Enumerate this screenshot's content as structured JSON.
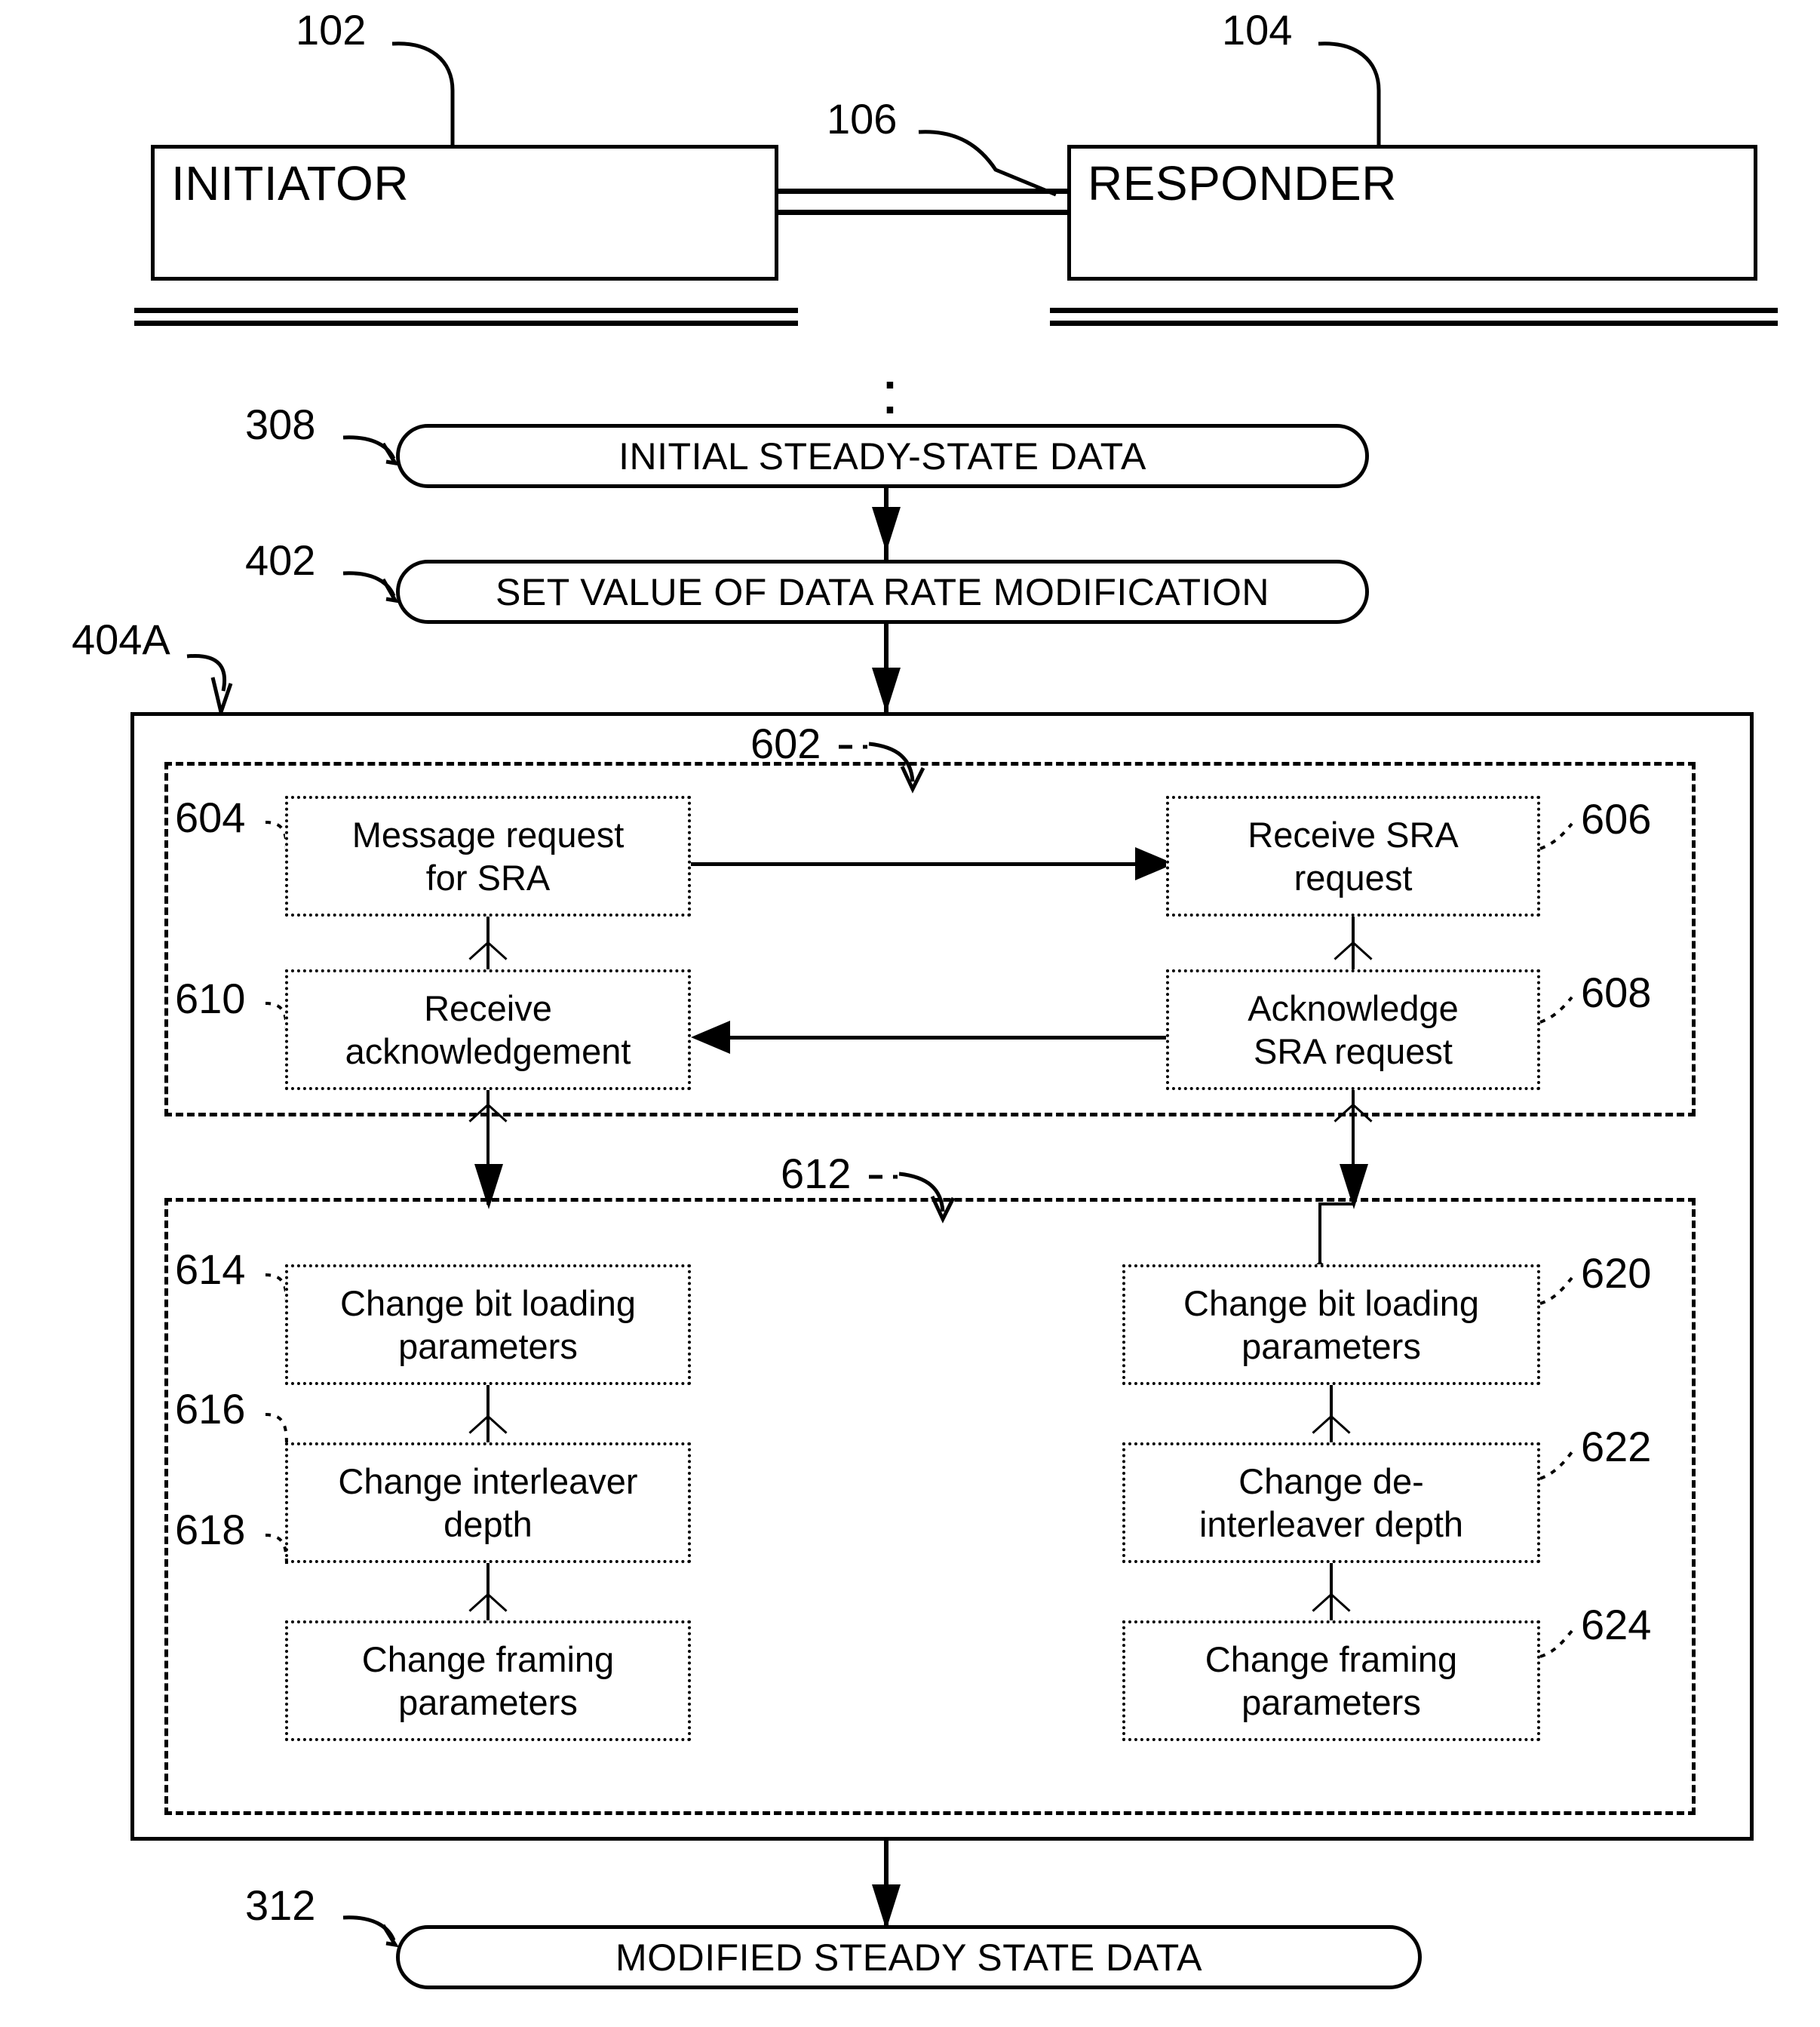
{
  "figure": {
    "type": "patent-flow-diagram",
    "top_blocks": [
      {
        "ref": "102",
        "label": "INITIATOR"
      },
      {
        "ref": "104",
        "label": "RESPONDER"
      }
    ],
    "link": {
      "ref": "106",
      "label": ""
    },
    "terminals": [
      {
        "ref": "308",
        "label": "INITIAL STEADY-STATE DATA"
      },
      {
        "ref": "402",
        "label": "SET VALUE OF DATA RATE MODIFICATION"
      },
      {
        "ref": "312",
        "label": "MODIFIED STEADY STATE DATA"
      }
    ],
    "outer_container": {
      "ref": "404A"
    },
    "groups": [
      {
        "ref": "602",
        "steps": [
          {
            "ref": "604",
            "side": "left",
            "line1": "Message request",
            "line2": "for SRA"
          },
          {
            "ref": "606",
            "side": "right",
            "line1": "Receive SRA",
            "line2": "request"
          },
          {
            "ref": "610",
            "side": "left",
            "line1": "Receive",
            "line2": "acknowledgement"
          },
          {
            "ref": "608",
            "side": "right",
            "line1": "Acknowledge",
            "line2": "SRA request"
          }
        ]
      },
      {
        "ref": "612",
        "steps": [
          {
            "ref": "614",
            "side": "left",
            "line1": "Change bit loading",
            "line2": "parameters"
          },
          {
            "ref": "620",
            "side": "right",
            "line1": "Change bit loading",
            "line2": "parameters"
          },
          {
            "ref": "616",
            "side": "left",
            "line1": "Change interleaver",
            "line2": "depth"
          },
          {
            "ref": "622",
            "side": "right",
            "line1": "Change de-",
            "line2": "interleaver depth"
          },
          {
            "ref": "618",
            "side": "left",
            "line1": "Change framing",
            "line2": "parameters"
          },
          {
            "ref": "624",
            "side": "right",
            "line1": "Change framing",
            "line2": "parameters"
          }
        ]
      }
    ],
    "ellipsis": "⋮",
    "colors": {
      "ink": "#000000",
      "paper": "#ffffff"
    }
  }
}
